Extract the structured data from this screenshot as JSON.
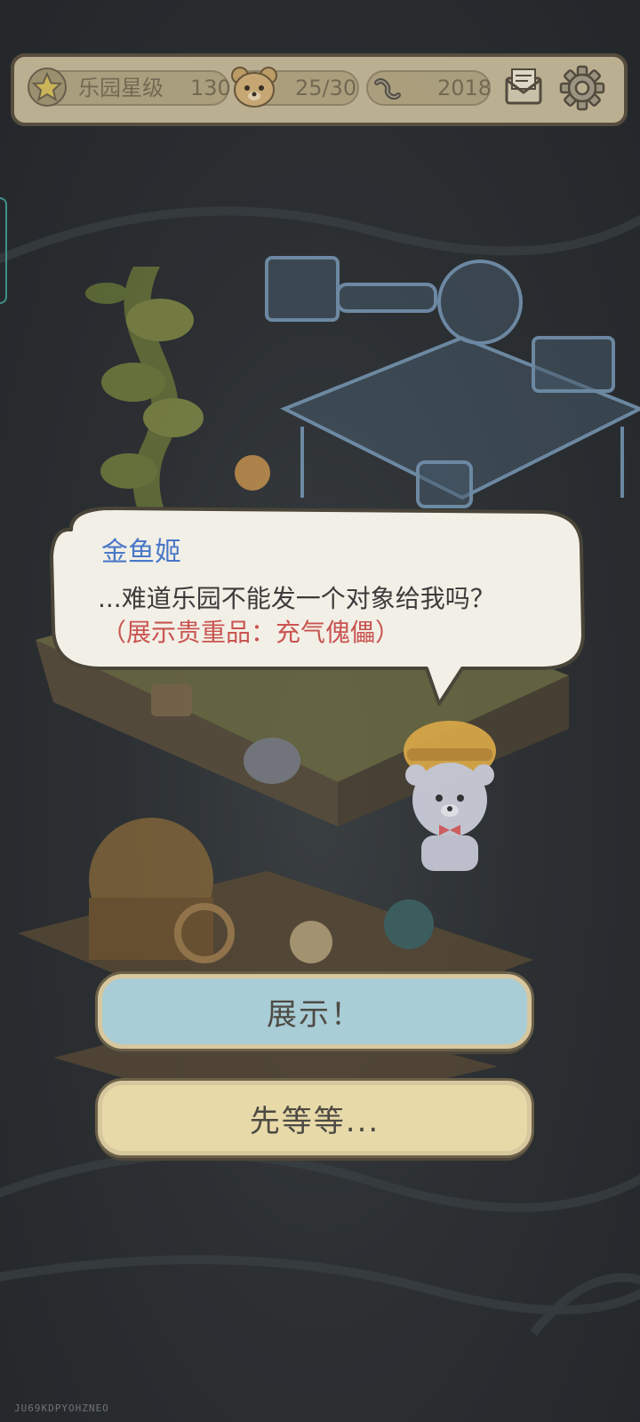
{
  "topbar": {
    "park_star_label": "乐园星级",
    "park_star_value": "130",
    "bear_count": "25/30",
    "currency_value": "2018",
    "icons": {
      "star": "star-icon",
      "bear": "bear-face-icon",
      "currency": "infinity-link-icon",
      "mail": "mail-icon",
      "settings": "gear-icon"
    }
  },
  "dialog": {
    "speaker": "金鱼姬",
    "line": "...难道乐园不能发一个对象给我吗？",
    "hint": "（展示贵重品：充气傀儡）"
  },
  "buttons": {
    "show": "展示！",
    "wait": "先等等..."
  },
  "watermark": "JU69KDPYOHZNEO",
  "colors": {
    "speaker": "#4a78c8",
    "hint": "#c95451",
    "show_button": "#a9cdd6",
    "wait_button": "#e8d9a9"
  }
}
